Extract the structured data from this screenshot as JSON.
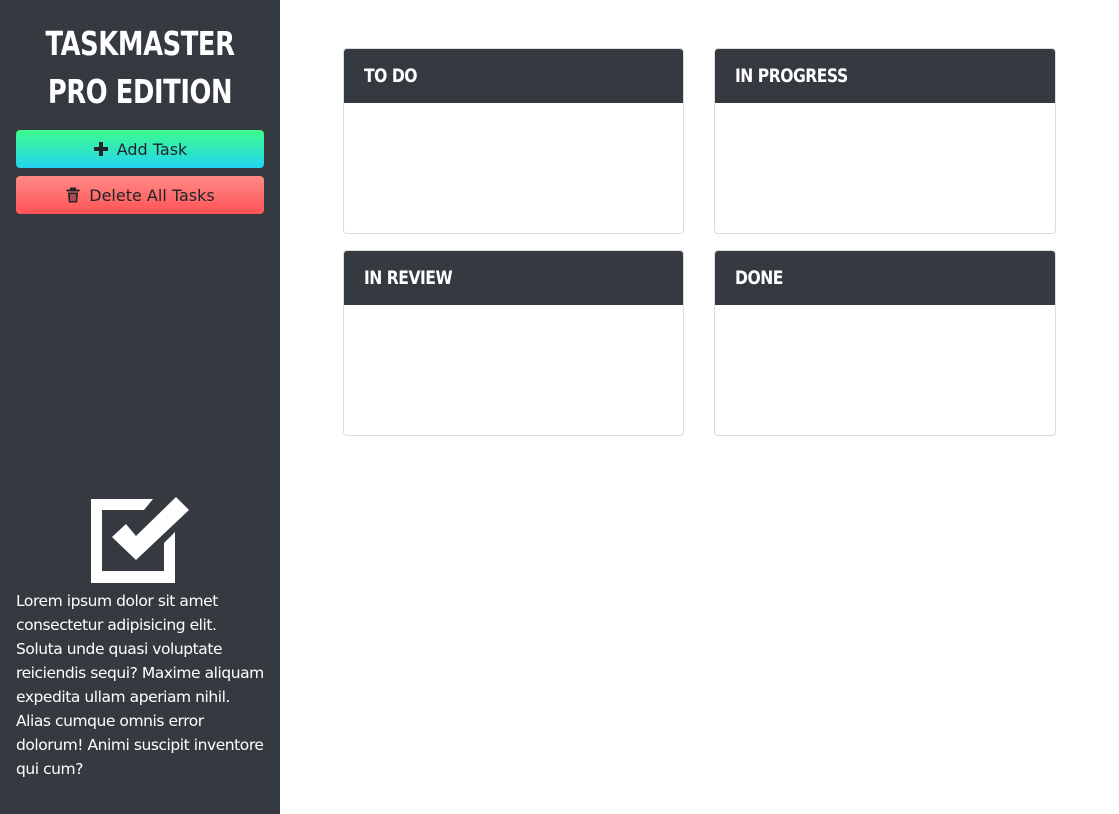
{
  "app": {
    "title": "TASKMASTER PRO EDITION"
  },
  "sidebar": {
    "add_label": "Add Task",
    "delete_label": "Delete All Tasks",
    "description": "Lorem ipsum dolor sit amet consectetur adipisicing elit. Soluta unde quasi voluptate reiciendis sequi? Maxime aliquam expedita ullam aperiam nihil. Alias cumque omnis error dolorum! Animi suscipit inventore qui cum?",
    "icons": {
      "add": "plus-icon",
      "delete": "trash-icon",
      "logo": "checkbox-checked-icon"
    }
  },
  "board": {
    "columns": [
      {
        "title": "TO DO"
      },
      {
        "title": "IN PROGRESS"
      },
      {
        "title": "IN REVIEW"
      },
      {
        "title": "DONE"
      }
    ]
  },
  "colors": {
    "sidebar_bg": "#343a40",
    "header_bg": "#343a40",
    "add_gradient_top": "#3efc8c",
    "add_gradient_bottom": "#22d4f0",
    "delete_gradient_top": "#ff8a85",
    "delete_gradient_bottom": "#ff5257"
  }
}
